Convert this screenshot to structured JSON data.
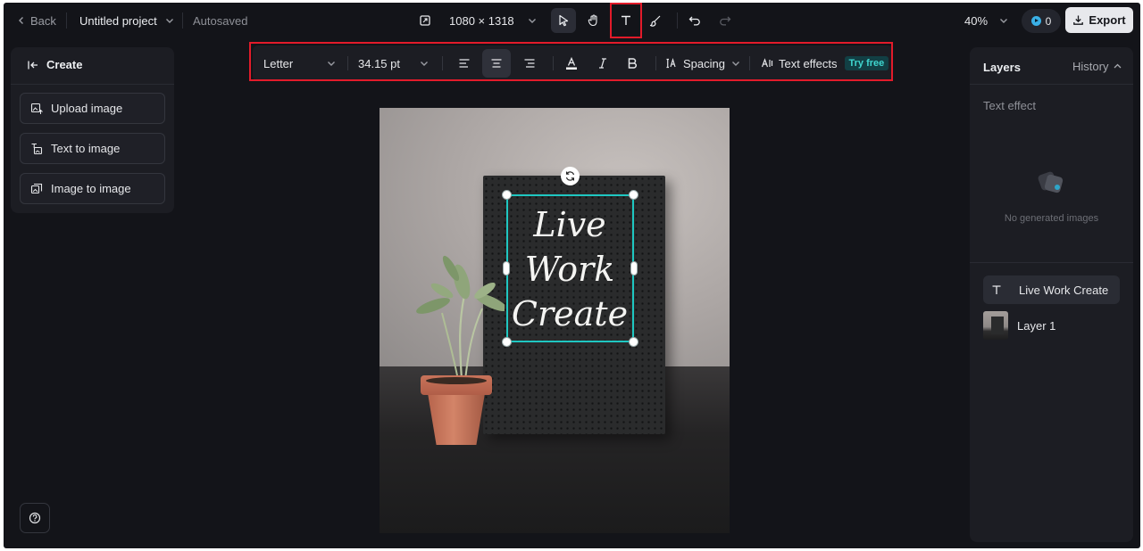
{
  "topbar": {
    "back_label": "Back",
    "project_name": "Untitled project",
    "autosave_status": "Autosaved",
    "canvas_size": "1080 × 1318",
    "zoom_level": "40%",
    "credits": "0",
    "export_label": "Export"
  },
  "text_toolbar": {
    "font": "Letter",
    "font_size": "34.15 pt",
    "spacing_label": "Spacing",
    "effects_label": "Text effects",
    "try_free_label": "Try free"
  },
  "left_panel": {
    "header": "Create",
    "buttons": [
      {
        "label": "Upload image"
      },
      {
        "label": "Text to image"
      },
      {
        "label": "Image to image"
      }
    ]
  },
  "canvas": {
    "text_lines": [
      "Live",
      "Work",
      "Create"
    ]
  },
  "right_panel": {
    "tab_layers": "Layers",
    "tab_history": "History",
    "section_title": "Text effect",
    "empty_state": "No generated images",
    "layers": [
      {
        "name": "Live Work Create",
        "type": "text"
      },
      {
        "name": "Layer 1",
        "type": "image"
      }
    ]
  },
  "colors": {
    "app_background": "#131419",
    "panel_background": "#1c1d23",
    "selection_accent": "#1fc7c1",
    "highlight_box": "#e21b2a",
    "export_button": "#e7e8ec"
  }
}
